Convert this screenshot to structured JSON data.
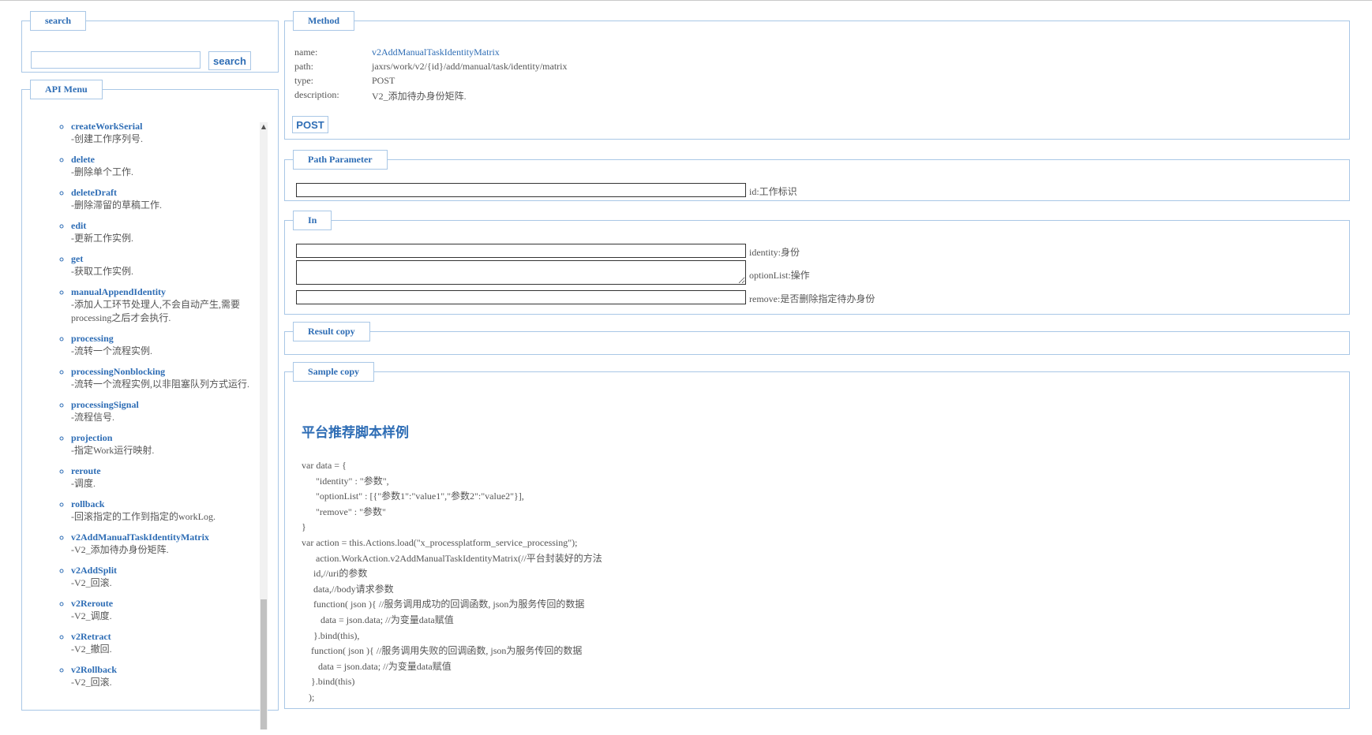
{
  "search": {
    "legend": "search",
    "input_value": "",
    "button_label": "search"
  },
  "menu": {
    "legend": "API Menu",
    "items": [
      {
        "name": "createWorkSerial",
        "desc": "-创建工作序列号."
      },
      {
        "name": "delete",
        "desc": "-删除单个工作."
      },
      {
        "name": "deleteDraft",
        "desc": "-删除滞留的草稿工作."
      },
      {
        "name": "edit",
        "desc": "-更新工作实例."
      },
      {
        "name": "get",
        "desc": "-获取工作实例."
      },
      {
        "name": "manualAppendIdentity",
        "desc": "-添加人工环节处理人,不会自动产生,需要processing之后才会执行."
      },
      {
        "name": "processing",
        "desc": "-流转一个流程实例."
      },
      {
        "name": "processingNonblocking",
        "desc": "-流转一个流程实例,以非阻塞队列方式运行."
      },
      {
        "name": "processingSignal",
        "desc": "-流程信号."
      },
      {
        "name": "projection",
        "desc": "-指定Work运行映射."
      },
      {
        "name": "reroute",
        "desc": "-调度."
      },
      {
        "name": "rollback",
        "desc": "-回滚指定的工作到指定的workLog."
      },
      {
        "name": "v2AddManualTaskIdentityMatrix",
        "desc": "-V2_添加待办身份矩阵."
      },
      {
        "name": "v2AddSplit",
        "desc": "-V2_回滚."
      },
      {
        "name": "v2Reroute",
        "desc": "-V2_调度."
      },
      {
        "name": "v2Retract",
        "desc": "-V2_撤回."
      },
      {
        "name": "v2Rollback",
        "desc": "-V2_回滚."
      }
    ]
  },
  "method": {
    "legend": "Method",
    "name_label": "name:",
    "name_value": "v2AddManualTaskIdentityMatrix",
    "path_label": "path:",
    "path_value": "jaxrs/work/v2/{id}/add/manual/task/identity/matrix",
    "type_label": "type:",
    "type_value": "POST",
    "description_label": "description:",
    "description_value": "V2_添加待办身份矩阵.",
    "button_label": "POST"
  },
  "path_parameter": {
    "legend": "Path Parameter",
    "params": [
      {
        "value": "",
        "label": "id:工作标识"
      }
    ]
  },
  "in": {
    "legend": "In",
    "params": [
      {
        "value": "",
        "label": "identity:身份"
      },
      {
        "value": "",
        "label": "optionList:操作"
      },
      {
        "value": "",
        "label": "remove:是否删除指定待办身份"
      }
    ]
  },
  "result": {
    "legend": "Result copy"
  },
  "sample": {
    "legend": "Sample copy",
    "title": "平台推荐脚本样例",
    "code_lines": [
      "var data = {",
      "      \"identity\" : \"参数\",",
      "      \"optionList\" : [{\"参数1\":\"value1\",\"参数2\":\"value2\"}],",
      "      \"remove\" : \"参数\"",
      "}",
      "var action = this.Actions.load(\"x_processplatform_service_processing\");",
      "      action.WorkAction.v2AddManualTaskIdentityMatrix(//平台封装好的方法",
      "     id,//uri的参数",
      "     data,//body请求参数",
      "     function( json ){ //服务调用成功的回调函数, json为服务传回的数据",
      "        data = json.data; //为变量data赋值",
      "     }.bind(this),",
      "    function( json ){ //服务调用失败的回调函数, json为服务传回的数据",
      "       data = json.data; //为变量data赋值",
      "    }.bind(this)",
      "   );"
    ]
  }
}
